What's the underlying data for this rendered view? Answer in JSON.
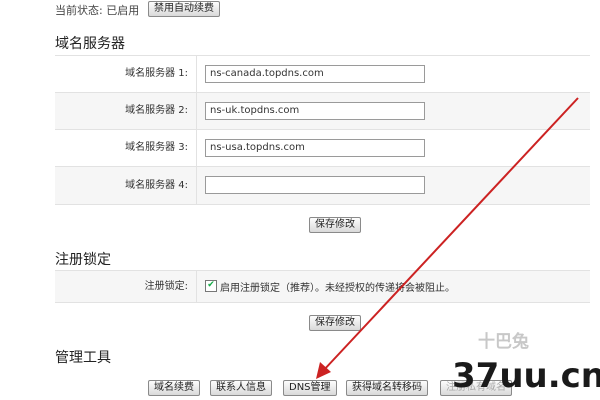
{
  "status": {
    "label": "当前状态: 已启用",
    "disable_button": "禁用自动续费"
  },
  "dns_section": {
    "title": "域名服务器",
    "rows": [
      {
        "label": "域名服务器 1:",
        "value": "ns-canada.topdns.com"
      },
      {
        "label": "域名服务器 2:",
        "value": "ns-uk.topdns.com"
      },
      {
        "label": "域名服务器 3:",
        "value": "ns-usa.topdns.com"
      },
      {
        "label": "域名服务器 4:",
        "value": ""
      }
    ],
    "save_button": "保存修改"
  },
  "lock_section": {
    "title": "注册锁定",
    "label": "注册锁定:",
    "checkbox_checked": true,
    "checkbox_text": "启用注册锁定（推荐）。未经授权的传递将会被阻止。",
    "save_button": "保存修改"
  },
  "tools_section": {
    "title": "管理工具",
    "buttons": [
      "域名续费",
      "联系人信息",
      "DNS管理",
      "获得域名转移码",
      "注册私有域名"
    ]
  },
  "annotation": {
    "arrow_color": "#cc2222"
  },
  "watermark": {
    "brand": "37uu.cn",
    "cn": "十巴兔"
  }
}
